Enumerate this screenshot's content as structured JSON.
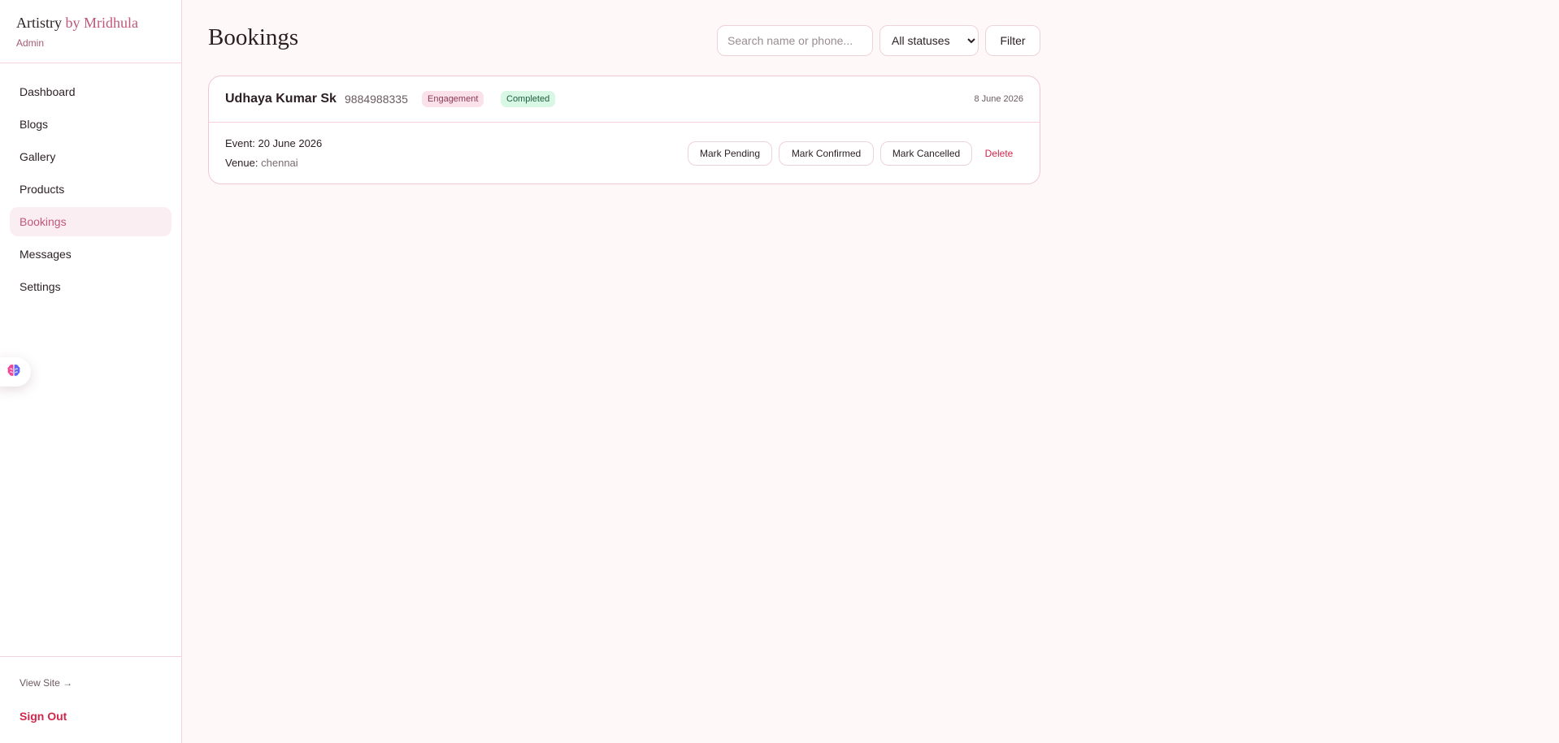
{
  "sidebar": {
    "brand_main": "Artistry",
    "brand_accent": "by Mridhula",
    "brand_sub": "Admin",
    "items": [
      {
        "label": "Dashboard",
        "active": false
      },
      {
        "label": "Blogs",
        "active": false
      },
      {
        "label": "Gallery",
        "active": false
      },
      {
        "label": "Products",
        "active": false
      },
      {
        "label": "Bookings",
        "active": true
      },
      {
        "label": "Messages",
        "active": false
      },
      {
        "label": "Settings",
        "active": false
      }
    ],
    "view_site": "View Site →",
    "sign_out": "Sign Out"
  },
  "header": {
    "title": "Bookings",
    "search_placeholder": "Search name or phone...",
    "status_filter_value": "All statuses",
    "filter_label": "Filter"
  },
  "bookings": [
    {
      "name": "Udhaya Kumar Sk",
      "phone": "9884988335",
      "type": "Engagement",
      "status": "Completed",
      "created": "8 June 2026",
      "event": "Event: 20 June 2026",
      "venue_label": "Venue:",
      "venue": "chennai",
      "actions": {
        "pending": "Mark Pending",
        "confirmed": "Mark Confirmed",
        "cancelled": "Mark Cancelled",
        "delete": "Delete"
      }
    }
  ],
  "colors": {
    "accent": "#c0577a",
    "danger": "#d0274c",
    "background": "#fff8f9",
    "completed_badge": "#d8f7e5",
    "type_badge": "#fbe1ea"
  },
  "icons": {
    "floating_widget": "brain-icon"
  }
}
